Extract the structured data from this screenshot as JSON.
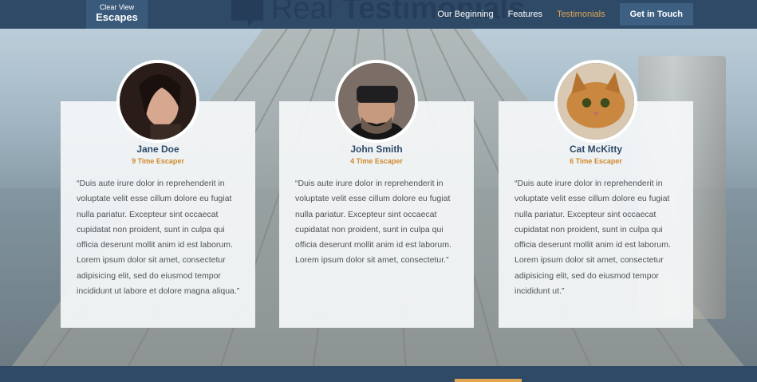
{
  "brand": {
    "line1": "Clear View",
    "line2": "Escapes"
  },
  "section_title": {
    "light": "Real",
    "bold": "Testimonials"
  },
  "nav": {
    "items": [
      "Our Beginning",
      "Features",
      "Testimonials"
    ],
    "active": "Testimonials",
    "cta": "Get in Touch"
  },
  "colors": {
    "nav_bg": "#2f4a67",
    "accent": "#e0a653",
    "name": "#2e4a68"
  },
  "testimonials": [
    {
      "name": "Jane Doe",
      "subtitle": "9 Time Escaper",
      "avatar": "woman-portrait",
      "quote": "“Duis aute irure dolor in reprehenderit in voluptate velit esse cillum dolore eu fugiat nulla pariatur. Excepteur sint occaecat cupidatat non proident, sunt in culpa qui officia deserunt mollit anim id est laborum. Lorem ipsum dolor sit amet, consectetur adipisicing elit, sed do eiusmod tempor incididunt ut labore et dolore magna aliqua.”"
    },
    {
      "name": "John Smith",
      "subtitle": "4 Time Escaper",
      "avatar": "man-vr-headset",
      "quote": "“Duis aute irure dolor in reprehenderit in voluptate velit esse cillum dolore eu fugiat nulla pariatur. Excepteur sint occaecat cupidatat non proident, sunt in culpa qui officia deserunt mollit anim id est laborum. Lorem ipsum dolor sit amet, consectetur.”"
    },
    {
      "name": "Cat McKitty",
      "subtitle": "6 Time Escaper",
      "avatar": "cat-portrait",
      "quote": "“Duis aute irure dolor in reprehenderit in voluptate velit esse cillum dolore eu fugiat nulla pariatur. Excepteur sint occaecat cupidatat non proident, sunt in culpa qui officia deserunt mollit anim id est laborum. Lorem ipsum dolor sit amet, consectetur adipisicing elit, sed do eiusmod tempor incididunt ut.”"
    }
  ]
}
